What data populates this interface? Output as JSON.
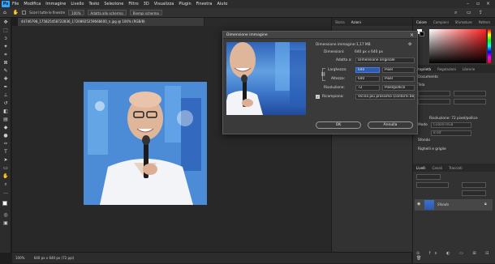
{
  "menubar": {
    "logo": "Ps",
    "items": [
      "File",
      "Modifica",
      "Immagine",
      "Livello",
      "Testo",
      "Selezione",
      "Filtro",
      "3D",
      "Visualizza",
      "Plugin",
      "Finestra",
      "Aiuto"
    ]
  },
  "options": {
    "chip1": "Scorri tutte le finestre",
    "zoom": "100%",
    "chip2": "Adatta allo schermo",
    "chip3": "Riempi schermo"
  },
  "document": {
    "tab_title": "44746798_175825458722836_17208925259668400_n.jpg @ 100% (RGB/8)",
    "status_zoom": "100%",
    "status_size": "640 px x 640 px (72 ppi)"
  },
  "midpanel": {
    "tabs": [
      "Storia",
      "Azioni"
    ],
    "right_tabs": [
      "Colore",
      "Campioni",
      "Sfumature",
      "Pattern"
    ],
    "section_tabs": [
      "Proprietà",
      "Regolazioni",
      "Librerie"
    ],
    "doc_label": "Documento",
    "tela_label": "Tela",
    "risoluzione_label": "Risoluzione: 72 pixel/pollice",
    "modo_label": "Modo",
    "modo_value": "Colore RGB",
    "bit_value": "8 bit",
    "sfondo_label": "Sfondo",
    "righelli_label": "Righelli e griglie"
  },
  "layers": {
    "tabs": [
      "Livelli",
      "Canali",
      "Tracciati"
    ],
    "layer_name": "Sfondo"
  },
  "dialog": {
    "title": "Dimensione immagine",
    "dim_img_label": "Dimensione immagine:",
    "dim_img_value": "1,17 MB",
    "dimensioni_label": "Dimensioni:",
    "dimensioni_value": "640 px x 640 px",
    "adatta_label": "Adatta a:",
    "adatta_value": "Dimensione originale",
    "larghezza_label": "Larghezza:",
    "larghezza_value": "640",
    "larghezza_unit": "Pixel",
    "altezza_label": "Altezza:",
    "altezza_value": "640",
    "altezza_unit": "Pixel",
    "risoluzione_label": "Risoluzione:",
    "risoluzione_value": "72",
    "risoluzione_unit": "Pixel/pollice",
    "ricampiona_label": "Ricampiona:",
    "ricampiona_value": "Vicina più prossima (contorni be...",
    "ok_label": "OK",
    "cancel_label": "Annulla"
  },
  "colors": {
    "accent": "#31a8ff",
    "panel": "#323232",
    "canvas": "#282828",
    "selection": "#2e5bb0"
  }
}
